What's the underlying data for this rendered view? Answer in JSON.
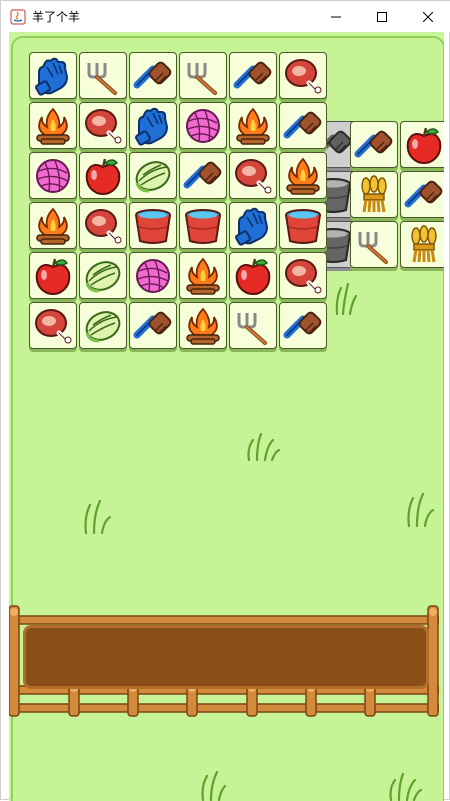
{
  "window": {
    "title": "羊了个羊",
    "controls": [
      "minimize",
      "maximize",
      "close"
    ]
  },
  "colors": {
    "background": "#c6f396",
    "tile_face": "#f6ffd9",
    "slot_bar": "#8a4f17",
    "fence": "#d38a3a"
  },
  "board": {
    "main_rows": [
      [
        "glove-icon",
        "rake-icon",
        "brush-icon",
        "rake-icon",
        "brush-icon",
        "meat-icon"
      ],
      [
        "campfire-icon",
        "meat-icon",
        "glove-icon",
        "yarn-icon",
        "campfire-icon",
        "brush-icon"
      ],
      [
        "yarn-icon",
        "apple-icon",
        "cabbage-icon",
        "brush-icon",
        "meat-icon",
        "campfire-icon"
      ],
      [
        "campfire-icon",
        "meat-icon",
        "bucket-icon",
        "bucket-icon",
        "glove-icon",
        "bucket-icon"
      ],
      [
        "apple-icon",
        "cabbage-icon",
        "yarn-icon",
        "campfire-icon",
        "apple-icon",
        "meat-icon"
      ],
      [
        "meat-icon",
        "cabbage-icon",
        "brush-icon",
        "campfire-icon",
        "rake-icon",
        "brush-icon"
      ]
    ],
    "side_rows": [
      [
        "brush-icon",
        "apple-icon"
      ],
      [
        "wheat-icon",
        "brush-icon"
      ],
      [
        "rake-icon",
        "wheat-icon"
      ]
    ]
  },
  "slot_bar": {
    "capacity": 7,
    "filled": 0
  }
}
